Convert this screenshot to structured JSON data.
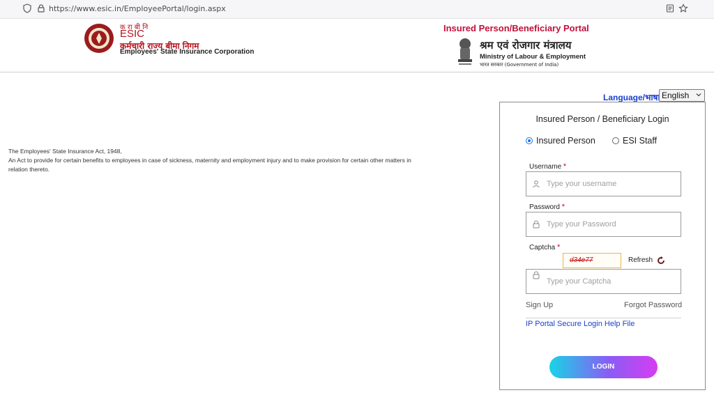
{
  "browser": {
    "url": "https://www.esic.in/EmployeePortal/login.aspx"
  },
  "header": {
    "esic_hindi_top": "क रा बी नि",
    "esic_name": "ESIC",
    "esic_hindi_name": "कर्मचारी राज्य बीमा निगम",
    "esic_english_name": "Employees' State Insurance Corporation",
    "portal_title": "Insured Person/Beneficiary Portal",
    "ministry_hindi": "श्रम एवं रोजगार मंत्रालय",
    "ministry_english": "Ministry of Labour & Employment",
    "govt_hindi": "भारत सरकार (Government of India)"
  },
  "act": {
    "line1": "The Employees' State Insurance Act, 1948,",
    "line2": "An Act to provide for certain benefits to employees in case of sickness, maternity and employment injury and to make provision for certain other matters in",
    "line3": "relation thereto."
  },
  "language": {
    "label": "Language/भाषा:",
    "selected": "English"
  },
  "login": {
    "title": "Insured Person / Beneficiary Login",
    "radio_ip": "Insured Person",
    "radio_staff": "ESI Staff",
    "username_label": "Username",
    "username_placeholder": "Type your username",
    "password_label": "Password",
    "password_placeholder": "Type your Password",
    "captcha_label": "Captcha",
    "captcha_value": "d34e77",
    "refresh_label": "Refresh",
    "captcha_placeholder": "Type your Captcha",
    "required_mark": "*",
    "signup": "Sign Up",
    "forgot": "Forgot Password",
    "help_link": "IP Portal Secure Login Help File",
    "login_button": "LOGIN"
  }
}
